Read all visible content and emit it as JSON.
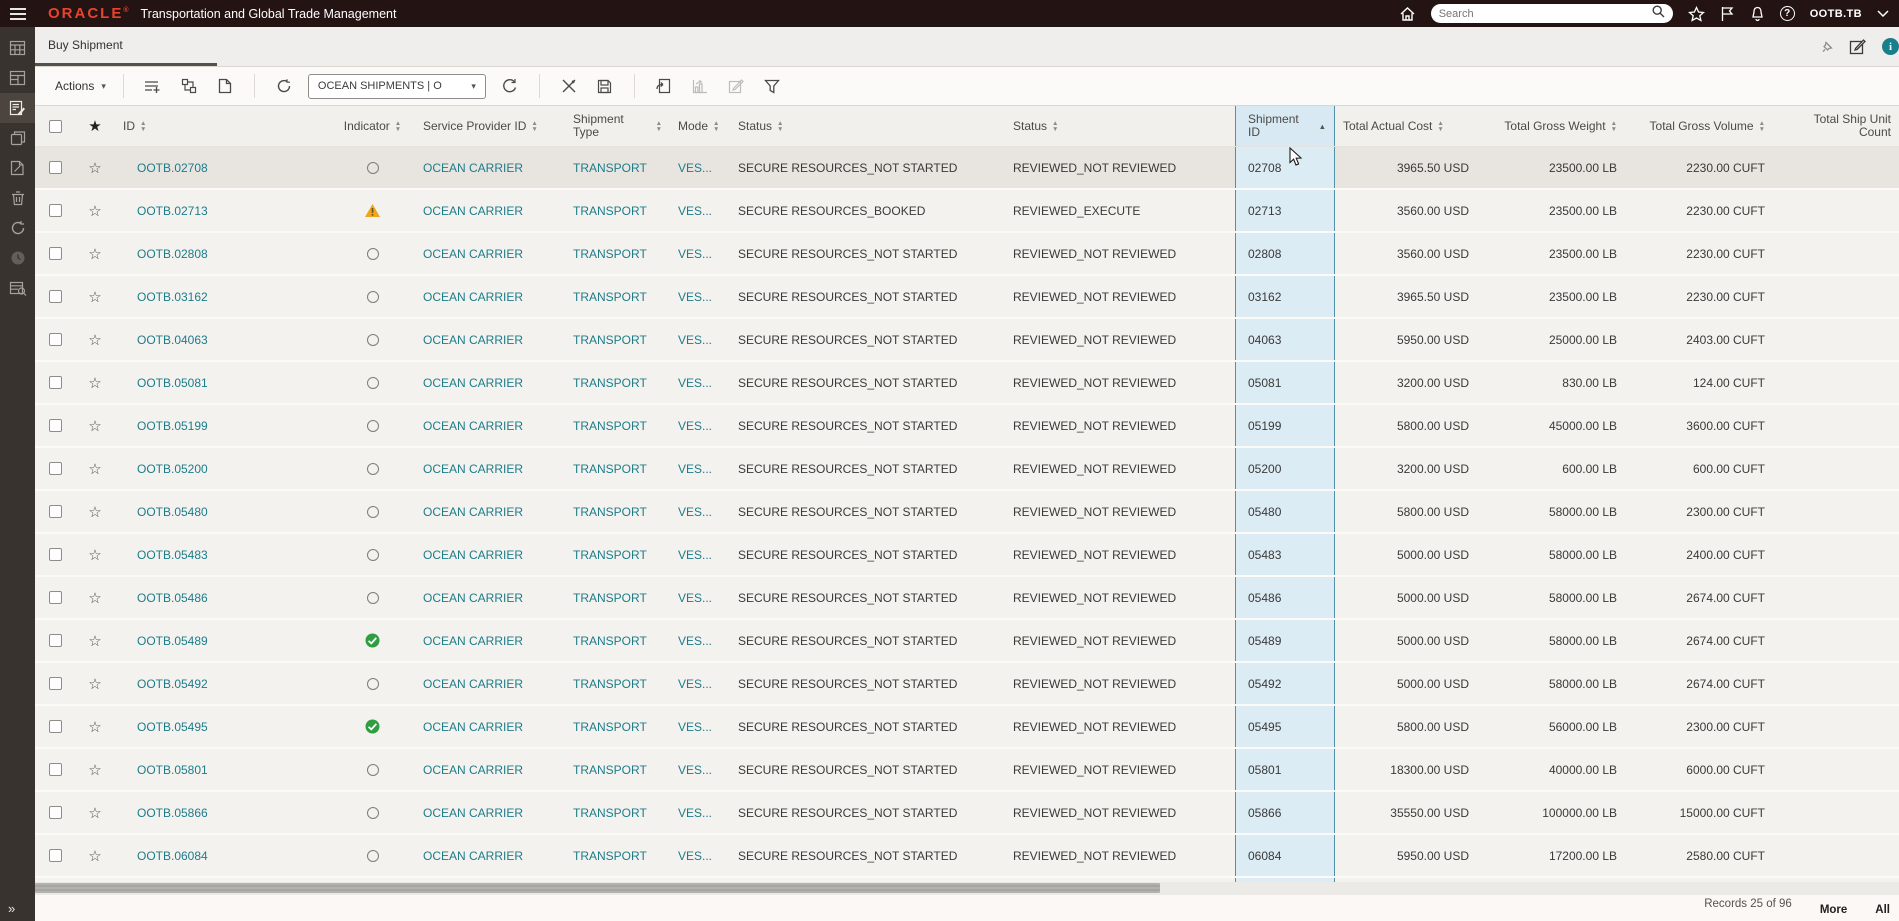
{
  "topbar": {
    "brand": "ORACLE",
    "app_title": "Transportation and Global Trade Management",
    "search_placeholder": "Search",
    "username": "OOTB.TB"
  },
  "tabbar": {
    "active_tab": "Buy Shipment"
  },
  "toolbar": {
    "actions_label": "Actions",
    "saved_search_value": "OCEAN SHIPMENTS | O"
  },
  "icons": {
    "topbar": [
      "menu-icon",
      "home-icon",
      "search-icon",
      "favorites-star-icon",
      "flag-icon",
      "notifications-bell-icon",
      "help-icon",
      "user-chevron-icon"
    ],
    "tabbar": [
      "pin-icon",
      "compose-icon",
      "info-icon"
    ],
    "toolbar": [
      "add-to-list-icon",
      "hierarchy-icon",
      "new-document-icon",
      "refresh-icon",
      "reload-icon",
      "cut-icon",
      "save-icon",
      "export-icon",
      "chart-icon",
      "edit-icon",
      "filter-funnel-icon"
    ],
    "sidebar": [
      "shipments-grid-icon",
      "order-release-icon",
      "buy-shipment-icon",
      "copy-icon",
      "edit-document-icon",
      "delete-icon",
      "refresh-icon",
      "recent-clock-icon",
      "finder-results-icon"
    ]
  },
  "table": {
    "headers": [
      {
        "label": "ID",
        "sort": "both"
      },
      {
        "label": "Indicator",
        "sort": "both"
      },
      {
        "label": "Service Provider ID",
        "sort": "both"
      },
      {
        "label": "Shipment Type",
        "sort": "both"
      },
      {
        "label": "Mode",
        "sort": "both"
      },
      {
        "label": "Status",
        "sort": "both"
      },
      {
        "label": "Status",
        "sort": "both"
      },
      {
        "label": "Shipment ID",
        "sort": "asc"
      },
      {
        "label": "Total Actual Cost",
        "sort": "both"
      },
      {
        "label": "Total Gross Weight",
        "sort": "both"
      },
      {
        "label": "Total Gross Volume",
        "sort": "both"
      },
      {
        "label": "Total Ship Unit Count",
        "sort": "none"
      }
    ],
    "rows": [
      {
        "highlighted": true,
        "id": "OOTB.02708",
        "indicator": "circle",
        "service_provider": "OCEAN CARRIER",
        "shipment_type": "TRANSPORT",
        "mode": "VES...",
        "status_secure": "SECURE RESOURCES_NOT STARTED",
        "status_reviewed": "REVIEWED_NOT REVIEWED",
        "shipment_id": "02708",
        "total_actual_cost": "3965.50 USD",
        "total_gross_weight": "23500.00 LB",
        "total_gross_volume": "2230.00 CUFT",
        "total_ship_unit_count": ""
      },
      {
        "highlighted": false,
        "id": "OOTB.02713",
        "indicator": "warning",
        "service_provider": "OCEAN CARRIER",
        "shipment_type": "TRANSPORT",
        "mode": "VES...",
        "status_secure": "SECURE RESOURCES_BOOKED",
        "status_reviewed": "REVIEWED_EXECUTE",
        "shipment_id": "02713",
        "total_actual_cost": "3560.00 USD",
        "total_gross_weight": "23500.00 LB",
        "total_gross_volume": "2230.00 CUFT",
        "total_ship_unit_count": ""
      },
      {
        "highlighted": false,
        "id": "OOTB.02808",
        "indicator": "circle",
        "service_provider": "OCEAN CARRIER",
        "shipment_type": "TRANSPORT",
        "mode": "VES...",
        "status_secure": "SECURE RESOURCES_NOT STARTED",
        "status_reviewed": "REVIEWED_NOT REVIEWED",
        "shipment_id": "02808",
        "total_actual_cost": "3560.00 USD",
        "total_gross_weight": "23500.00 LB",
        "total_gross_volume": "2230.00 CUFT",
        "total_ship_unit_count": ""
      },
      {
        "highlighted": false,
        "id": "OOTB.03162",
        "indicator": "circle",
        "service_provider": "OCEAN CARRIER",
        "shipment_type": "TRANSPORT",
        "mode": "VES...",
        "status_secure": "SECURE RESOURCES_NOT STARTED",
        "status_reviewed": "REVIEWED_NOT REVIEWED",
        "shipment_id": "03162",
        "total_actual_cost": "3965.50 USD",
        "total_gross_weight": "23500.00 LB",
        "total_gross_volume": "2230.00 CUFT",
        "total_ship_unit_count": ""
      },
      {
        "highlighted": false,
        "id": "OOTB.04063",
        "indicator": "circle",
        "service_provider": "OCEAN CARRIER",
        "shipment_type": "TRANSPORT",
        "mode": "VES...",
        "status_secure": "SECURE RESOURCES_NOT STARTED",
        "status_reviewed": "REVIEWED_NOT REVIEWED",
        "shipment_id": "04063",
        "total_actual_cost": "5950.00 USD",
        "total_gross_weight": "25000.00 LB",
        "total_gross_volume": "2403.00 CUFT",
        "total_ship_unit_count": ""
      },
      {
        "highlighted": false,
        "id": "OOTB.05081",
        "indicator": "circle",
        "service_provider": "OCEAN CARRIER",
        "shipment_type": "TRANSPORT",
        "mode": "VES...",
        "status_secure": "SECURE RESOURCES_NOT STARTED",
        "status_reviewed": "REVIEWED_NOT REVIEWED",
        "shipment_id": "05081",
        "total_actual_cost": "3200.00 USD",
        "total_gross_weight": "830.00 LB",
        "total_gross_volume": "124.00 CUFT",
        "total_ship_unit_count": ""
      },
      {
        "highlighted": false,
        "id": "OOTB.05199",
        "indicator": "circle",
        "service_provider": "OCEAN CARRIER",
        "shipment_type": "TRANSPORT",
        "mode": "VES...",
        "status_secure": "SECURE RESOURCES_NOT STARTED",
        "status_reviewed": "REVIEWED_NOT REVIEWED",
        "shipment_id": "05199",
        "total_actual_cost": "5800.00 USD",
        "total_gross_weight": "45000.00 LB",
        "total_gross_volume": "3600.00 CUFT",
        "total_ship_unit_count": ""
      },
      {
        "highlighted": false,
        "id": "OOTB.05200",
        "indicator": "circle",
        "service_provider": "OCEAN CARRIER",
        "shipment_type": "TRANSPORT",
        "mode": "VES...",
        "status_secure": "SECURE RESOURCES_NOT STARTED",
        "status_reviewed": "REVIEWED_NOT REVIEWED",
        "shipment_id": "05200",
        "total_actual_cost": "3200.00 USD",
        "total_gross_weight": "600.00 LB",
        "total_gross_volume": "600.00 CUFT",
        "total_ship_unit_count": ""
      },
      {
        "highlighted": false,
        "id": "OOTB.05480",
        "indicator": "circle",
        "service_provider": "OCEAN CARRIER",
        "shipment_type": "TRANSPORT",
        "mode": "VES...",
        "status_secure": "SECURE RESOURCES_NOT STARTED",
        "status_reviewed": "REVIEWED_NOT REVIEWED",
        "shipment_id": "05480",
        "total_actual_cost": "5800.00 USD",
        "total_gross_weight": "58000.00 LB",
        "total_gross_volume": "2300.00 CUFT",
        "total_ship_unit_count": ""
      },
      {
        "highlighted": false,
        "id": "OOTB.05483",
        "indicator": "circle",
        "service_provider": "OCEAN CARRIER",
        "shipment_type": "TRANSPORT",
        "mode": "VES...",
        "status_secure": "SECURE RESOURCES_NOT STARTED",
        "status_reviewed": "REVIEWED_NOT REVIEWED",
        "shipment_id": "05483",
        "total_actual_cost": "5000.00 USD",
        "total_gross_weight": "58000.00 LB",
        "total_gross_volume": "2400.00 CUFT",
        "total_ship_unit_count": ""
      },
      {
        "highlighted": false,
        "id": "OOTB.05486",
        "indicator": "circle",
        "service_provider": "OCEAN CARRIER",
        "shipment_type": "TRANSPORT",
        "mode": "VES...",
        "status_secure": "SECURE RESOURCES_NOT STARTED",
        "status_reviewed": "REVIEWED_NOT REVIEWED",
        "shipment_id": "05486",
        "total_actual_cost": "5000.00 USD",
        "total_gross_weight": "58000.00 LB",
        "total_gross_volume": "2674.00 CUFT",
        "total_ship_unit_count": ""
      },
      {
        "highlighted": false,
        "id": "OOTB.05489",
        "indicator": "check",
        "service_provider": "OCEAN CARRIER",
        "shipment_type": "TRANSPORT",
        "mode": "VES...",
        "status_secure": "SECURE RESOURCES_NOT STARTED",
        "status_reviewed": "REVIEWED_NOT REVIEWED",
        "shipment_id": "05489",
        "total_actual_cost": "5000.00 USD",
        "total_gross_weight": "58000.00 LB",
        "total_gross_volume": "2674.00 CUFT",
        "total_ship_unit_count": ""
      },
      {
        "highlighted": false,
        "id": "OOTB.05492",
        "indicator": "circle",
        "service_provider": "OCEAN CARRIER",
        "shipment_type": "TRANSPORT",
        "mode": "VES...",
        "status_secure": "SECURE RESOURCES_NOT STARTED",
        "status_reviewed": "REVIEWED_NOT REVIEWED",
        "shipment_id": "05492",
        "total_actual_cost": "5000.00 USD",
        "total_gross_weight": "58000.00 LB",
        "total_gross_volume": "2674.00 CUFT",
        "total_ship_unit_count": ""
      },
      {
        "highlighted": false,
        "id": "OOTB.05495",
        "indicator": "check",
        "service_provider": "OCEAN CARRIER",
        "shipment_type": "TRANSPORT",
        "mode": "VES...",
        "status_secure": "SECURE RESOURCES_NOT STARTED",
        "status_reviewed": "REVIEWED_NOT REVIEWED",
        "shipment_id": "05495",
        "total_actual_cost": "5800.00 USD",
        "total_gross_weight": "56000.00 LB",
        "total_gross_volume": "2300.00 CUFT",
        "total_ship_unit_count": ""
      },
      {
        "highlighted": false,
        "id": "OOTB.05801",
        "indicator": "circle",
        "service_provider": "OCEAN CARRIER",
        "shipment_type": "TRANSPORT",
        "mode": "VES...",
        "status_secure": "SECURE RESOURCES_NOT STARTED",
        "status_reviewed": "REVIEWED_NOT REVIEWED",
        "shipment_id": "05801",
        "total_actual_cost": "18300.00 USD",
        "total_gross_weight": "40000.00 LB",
        "total_gross_volume": "6000.00 CUFT",
        "total_ship_unit_count": ""
      },
      {
        "highlighted": false,
        "id": "OOTB.05866",
        "indicator": "circle",
        "service_provider": "OCEAN CARRIER",
        "shipment_type": "TRANSPORT",
        "mode": "VES...",
        "status_secure": "SECURE RESOURCES_NOT STARTED",
        "status_reviewed": "REVIEWED_NOT REVIEWED",
        "shipment_id": "05866",
        "total_actual_cost": "35550.00 USD",
        "total_gross_weight": "100000.00 LB",
        "total_gross_volume": "15000.00 CUFT",
        "total_ship_unit_count": ""
      },
      {
        "highlighted": false,
        "id": "OOTB.06084",
        "indicator": "circle",
        "service_provider": "OCEAN CARRIER",
        "shipment_type": "TRANSPORT",
        "mode": "VES...",
        "status_secure": "SECURE RESOURCES_NOT STARTED",
        "status_reviewed": "REVIEWED_NOT REVIEWED",
        "shipment_id": "06084",
        "total_actual_cost": "5950.00 USD",
        "total_gross_weight": "17200.00 LB",
        "total_gross_volume": "2580.00 CUFT",
        "total_ship_unit_count": ""
      }
    ]
  },
  "footer": {
    "records": "Records 25 of 96",
    "more_label": "More",
    "all_label": "All"
  },
  "colors": {
    "topbar_bg": "#241313",
    "brand_red": "#e8432d",
    "sidebar_bg": "#38332e",
    "link_teal": "#1d7c89",
    "selected_column_bg": "#dcecf5",
    "selected_column_border": "#4e93a6",
    "warning_amber": "#f0a51e",
    "success_green": "#2f9e41"
  }
}
